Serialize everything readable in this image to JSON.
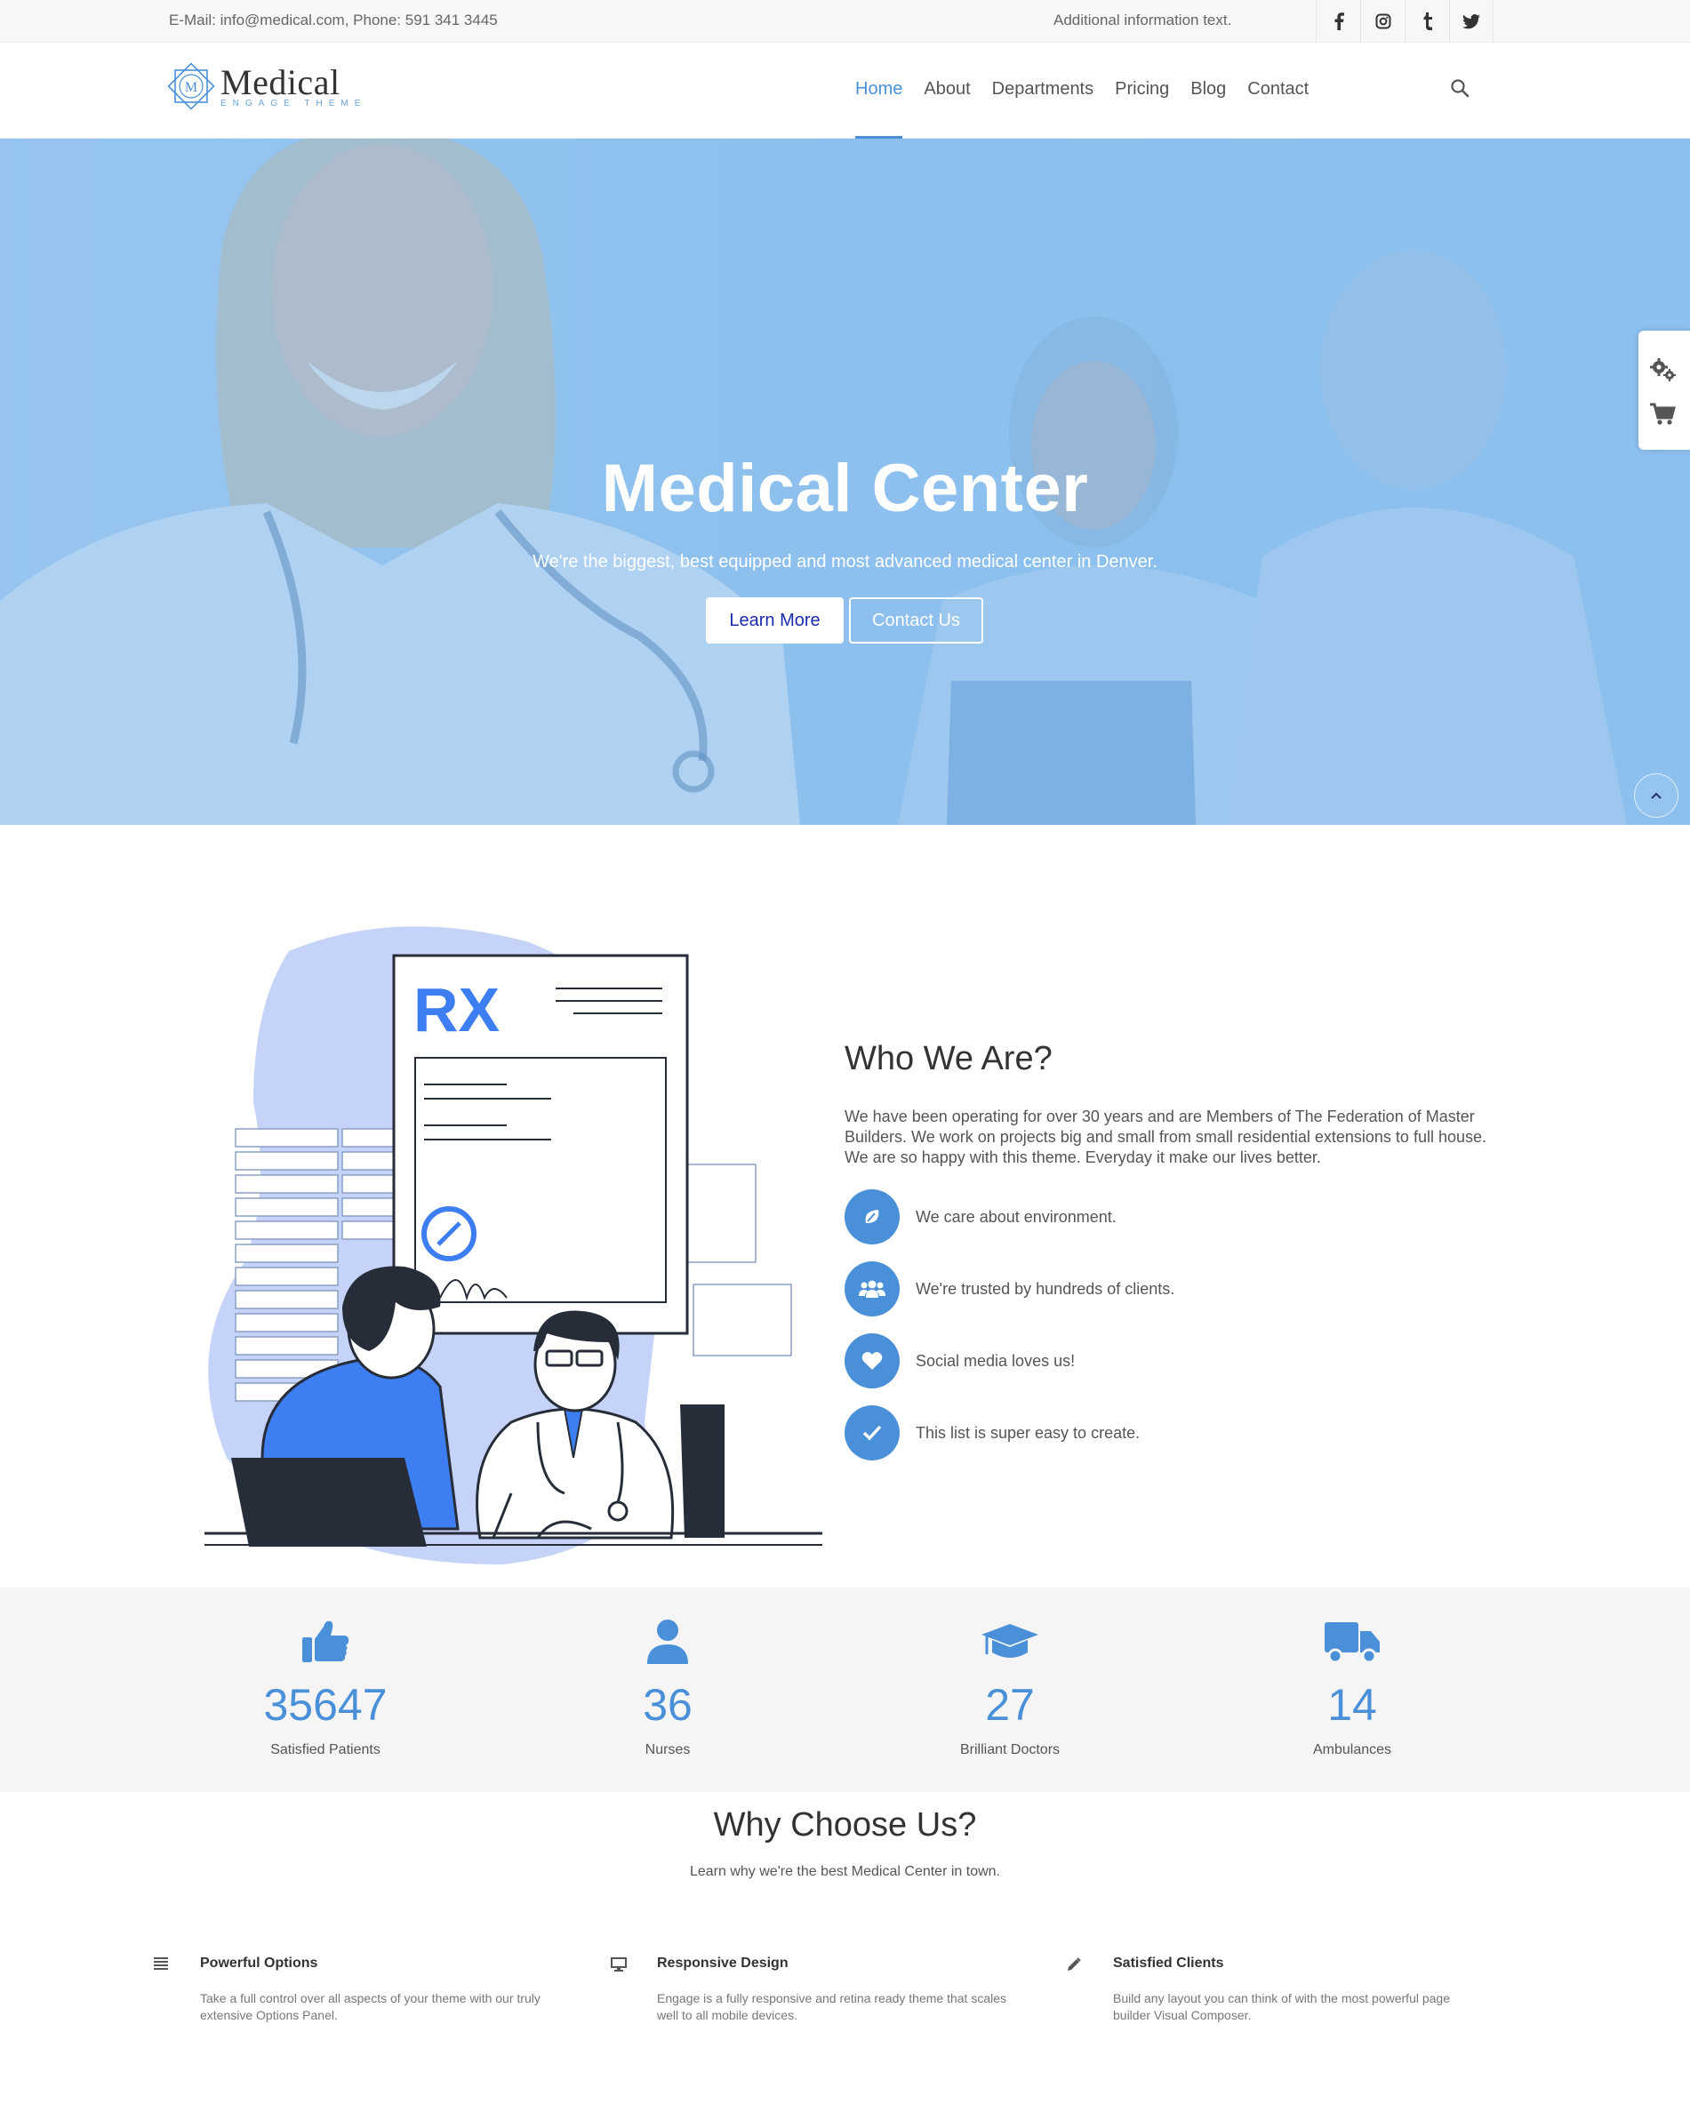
{
  "topbar": {
    "contact": "E-Mail: info@medical.com, Phone: 591 341 3445",
    "additional": "Additional information text.",
    "socials": [
      {
        "icon": "facebook-icon"
      },
      {
        "icon": "instagram-icon"
      },
      {
        "icon": "tumblr-icon"
      },
      {
        "icon": "twitter-icon"
      }
    ]
  },
  "header": {
    "logo_name": "Medical",
    "logo_tagline": "ENGAGE THEME",
    "nav": [
      "Home",
      "About",
      "Departments",
      "Pricing",
      "Blog",
      "Contact"
    ],
    "active_nav": "Home"
  },
  "hero": {
    "title": "Medical Center",
    "subtitle": "We're the biggest, best equipped and most advanced medical center in Denver.",
    "learn_more": "Learn More",
    "contact_us": "Contact Us"
  },
  "who": {
    "title": "Who We Are?",
    "text": "We have been operating for over 30 years and are Members of The Federation of Master Builders. We work on projects big and small from small residential extensions to full house. We are so happy with this theme. Everyday it make our lives better.",
    "features": [
      {
        "icon": "leaf-icon",
        "label": "We care about environment."
      },
      {
        "icon": "users-icon",
        "label": "We're trusted by hundreds of clients."
      },
      {
        "icon": "heart-icon",
        "label": "Social media loves us!"
      },
      {
        "icon": "check-icon",
        "label": "This list is super easy to create."
      }
    ],
    "illustration_rx": "RX"
  },
  "stats": [
    {
      "icon": "thumbs-up-icon",
      "value": "35647",
      "label": "Satisfied Patients"
    },
    {
      "icon": "user-icon",
      "value": "36",
      "label": "Nurses"
    },
    {
      "icon": "graduation-cap-icon",
      "value": "27",
      "label": "Brilliant Doctors"
    },
    {
      "icon": "truck-icon",
      "value": "14",
      "label": "Ambulances"
    }
  ],
  "why": {
    "title": "Why Choose Us?",
    "subtitle": "Learn why we're the best Medical Center in town.",
    "columns": [
      {
        "icon": "list-icon",
        "title": "Powerful Options",
        "text": "Take a full control over all aspects of your theme with our truly extensive Options Panel."
      },
      {
        "icon": "monitor-icon",
        "title": "Responsive Design",
        "text": "Engage is a fully responsive and retina ready theme that scales well to all mobile devices."
      },
      {
        "icon": "pencil-icon",
        "title": "Satisfied Clients",
        "text": "Build any layout you can think of with the most powerful page builder Visual Composer."
      }
    ]
  },
  "colors": {
    "accent": "#4a90d9",
    "hero_overlay": "#8fc1ed",
    "illustration_blob": "#c5d3f9",
    "illustration_blue": "#3d7ef2",
    "dark": "#262d38"
  }
}
